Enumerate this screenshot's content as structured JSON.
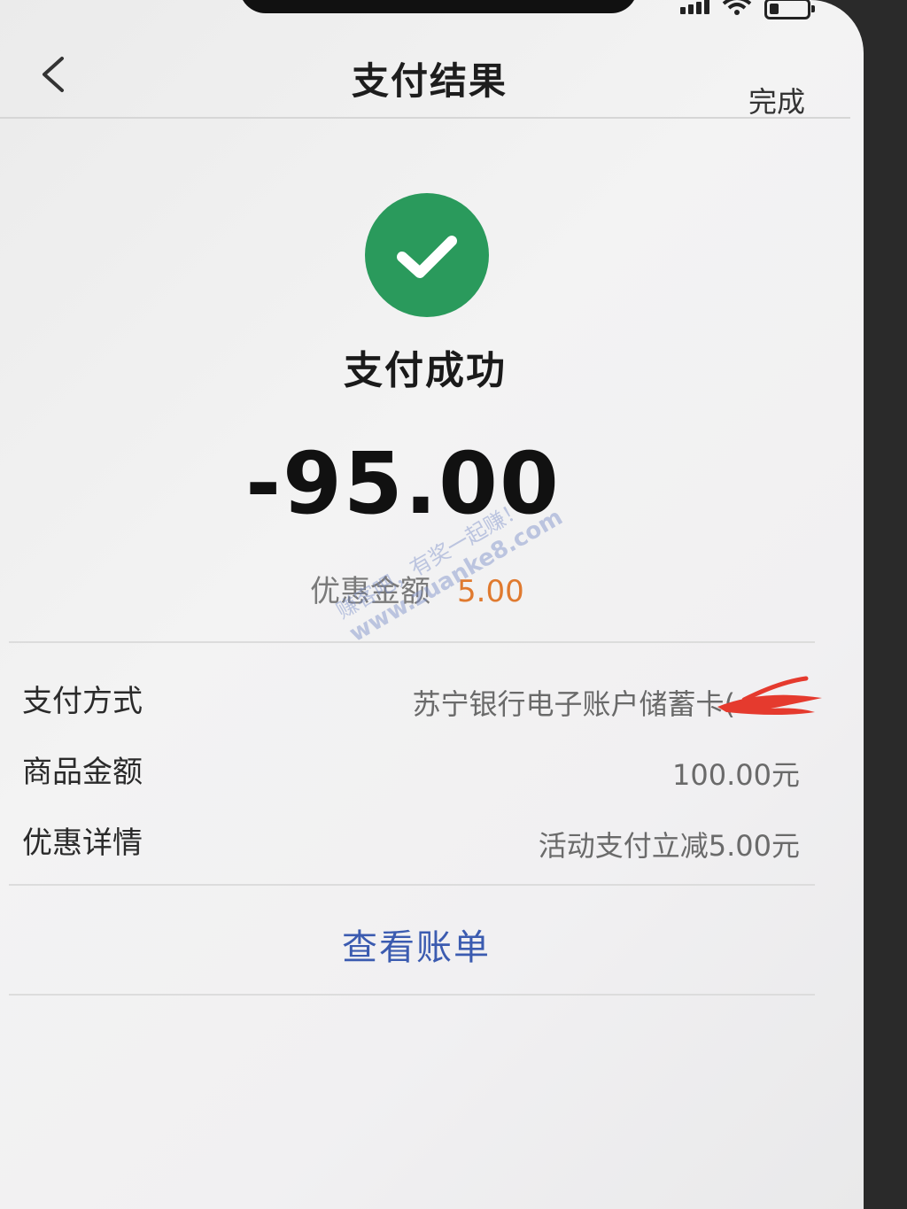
{
  "nav": {
    "title": "支付结果",
    "done_label": "完成"
  },
  "result": {
    "status_text": "支付成功",
    "amount": "-95.00",
    "discount_label": "优惠金额",
    "discount_value": "5.00"
  },
  "details": [
    {
      "label": "支付方式",
      "value": "苏宁银行电子账户储蓄卡("
    },
    {
      "label": "商品金额",
      "value": "100.00元"
    },
    {
      "label": "优惠详情",
      "value": "活动支付立减5.00元"
    }
  ],
  "actions": {
    "view_bill": "查看账单"
  },
  "watermark": {
    "line1": "赚客吧，有奖一起赚！",
    "line2": "www.zuanke8.com"
  },
  "colors": {
    "success": "#2a9a5c",
    "discount": "#e07a2f",
    "link": "#3b5bb0",
    "redaction": "#e53a2e"
  },
  "icons": [
    "signal-icon",
    "wifi-icon",
    "battery-icon",
    "back-icon",
    "checkmark-icon"
  ]
}
